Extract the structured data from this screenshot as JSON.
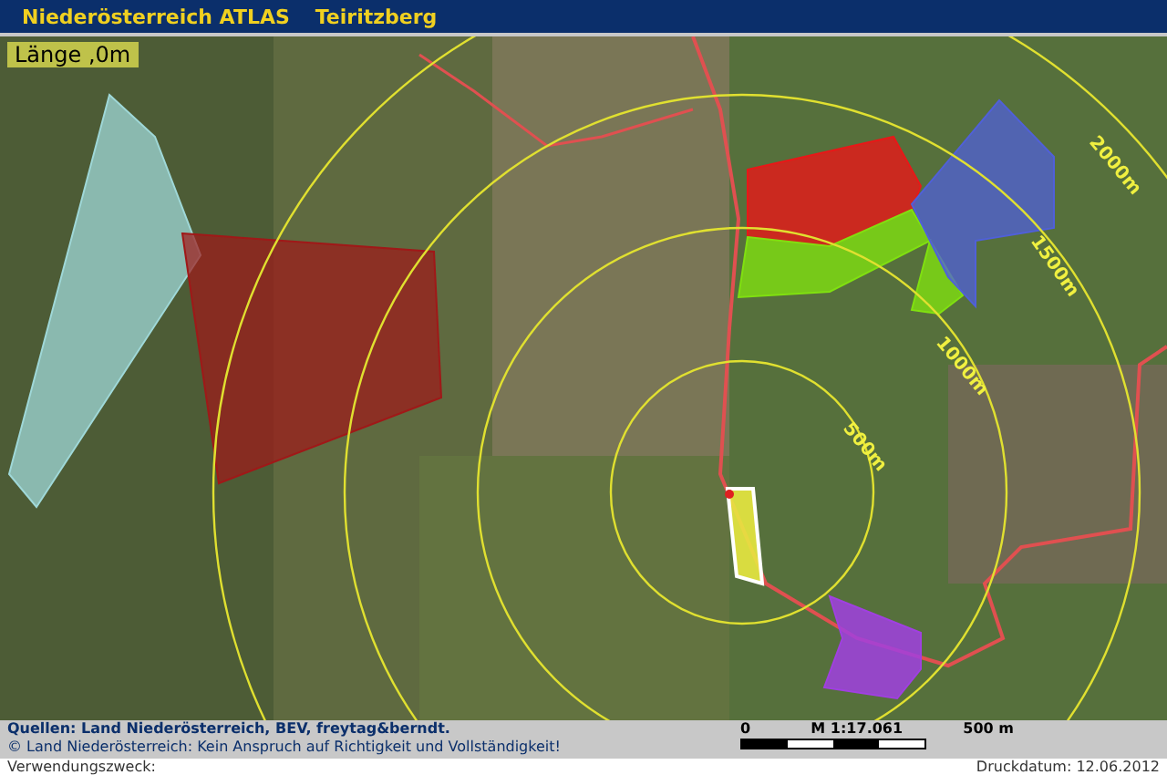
{
  "header": {
    "app_title": "Niederösterreich ATLAS",
    "place": "Teiritzberg"
  },
  "map": {
    "measure_label": "Länge ,0m",
    "rings": [
      {
        "label": "500m"
      },
      {
        "label": "1000m"
      },
      {
        "label": "1500m"
      },
      {
        "label": "2000m"
      }
    ],
    "zones": [
      {
        "color": "#9fd8d8"
      },
      {
        "color": "#a01818"
      },
      {
        "color": "#e81818"
      },
      {
        "color": "#80e010"
      },
      {
        "color": "#5060d8"
      },
      {
        "color": "#a040e0"
      },
      {
        "color": "#e8e840"
      }
    ]
  },
  "footer": {
    "sources": "Quellen: Land Niederösterreich, BEV, freytag&berndt.",
    "copyright": "© Land Niederösterreich: Kein Anspruch auf Richtigkeit und Vollständigkeit!",
    "scale": {
      "start": "0",
      "ratio": "M 1:17.061",
      "end": "500 m"
    }
  },
  "bottom": {
    "purpose": "Verwendungszweck:",
    "print_date": "Druckdatum: 12.06.2012"
  }
}
